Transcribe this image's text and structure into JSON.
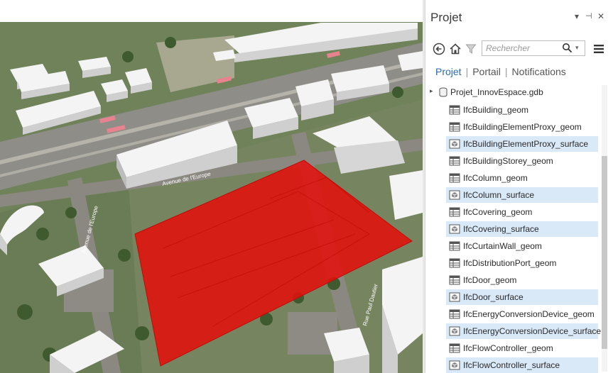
{
  "pane": {
    "title": "Projet",
    "controls": {
      "menu": "▾",
      "pin": "⊣",
      "close": "✕"
    },
    "toolbar": {
      "icons": [
        "back-icon",
        "home-icon",
        "filter-icon",
        "search-icon",
        "dropdown-arrow-icon",
        "menu-icon"
      ],
      "search_placeholder": "Rechercher"
    },
    "tabs": [
      {
        "label": "Projet",
        "active": true
      },
      {
        "label": "Portail",
        "active": false
      },
      {
        "label": "Notifications",
        "active": false
      }
    ],
    "tree": {
      "root": {
        "label": "Projet_InnovEspace.gdb",
        "expander": "▸"
      },
      "items": [
        {
          "label": "IfcBuilding_geom",
          "kind": "table",
          "selected": false
        },
        {
          "label": "IfcBuildingElementProxy_geom",
          "kind": "table",
          "selected": false
        },
        {
          "label": "IfcBuildingElementProxy_surface",
          "kind": "surface",
          "selected": true
        },
        {
          "label": "IfcBuildingStorey_geom",
          "kind": "table",
          "selected": false
        },
        {
          "label": "IfcColumn_geom",
          "kind": "table",
          "selected": false
        },
        {
          "label": "IfcColumn_surface",
          "kind": "surface",
          "selected": true
        },
        {
          "label": "IfcCovering_geom",
          "kind": "table",
          "selected": false
        },
        {
          "label": "IfcCovering_surface",
          "kind": "surface",
          "selected": true
        },
        {
          "label": "IfcCurtainWall_geom",
          "kind": "table",
          "selected": false
        },
        {
          "label": "IfcDistributionPort_geom",
          "kind": "table",
          "selected": false
        },
        {
          "label": "IfcDoor_geom",
          "kind": "table",
          "selected": false
        },
        {
          "label": "IfcDoor_surface",
          "kind": "surface",
          "selected": true
        },
        {
          "label": "IfcEnergyConversionDevice_geom",
          "kind": "table",
          "selected": false
        },
        {
          "label": "IfcEnergyConversionDevice_surface",
          "kind": "surface",
          "selected": true
        },
        {
          "label": "IfcFlowController_geom",
          "kind": "table",
          "selected": false
        },
        {
          "label": "IfcFlowController_surface",
          "kind": "surface",
          "selected": true
        }
      ]
    }
  },
  "map": {
    "street_labels": [
      "Avenue de l'Europe",
      "Avenue de l'Europe",
      "Rue Paul Dautier"
    ],
    "highlight_color": "#e3100d",
    "building_color": "#f2f2f2"
  }
}
